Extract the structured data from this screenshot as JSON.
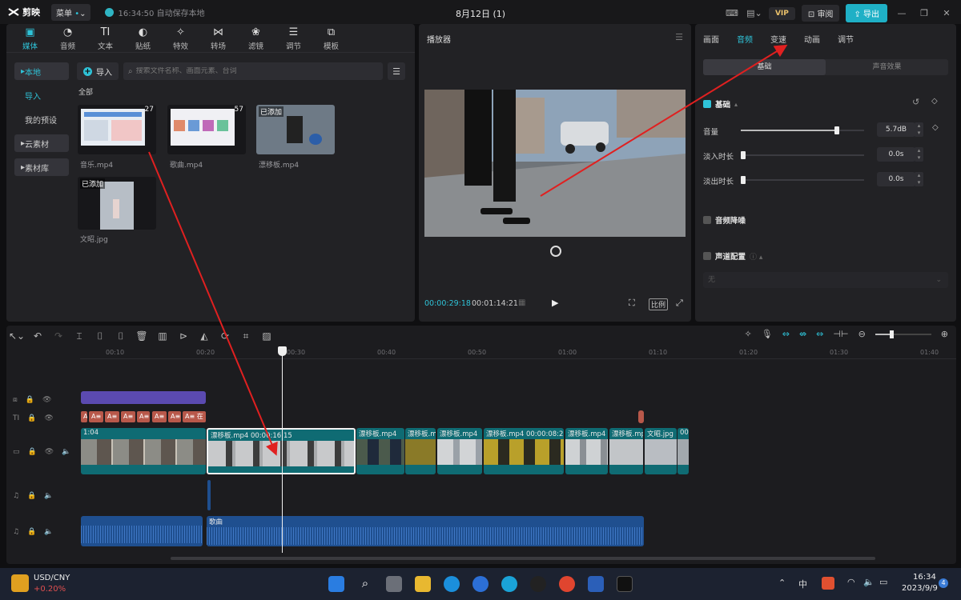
{
  "app": {
    "name": "剪映",
    "menu_label": "菜单",
    "autosave": "16:34:50 自动保存本地",
    "project_title": "8月12日 (1)",
    "vip": "VIP",
    "review": "审阅",
    "export": "导出"
  },
  "media_tabs": [
    {
      "icon": "media-icon",
      "label": "媒体"
    },
    {
      "icon": "audio-icon",
      "label": "音频"
    },
    {
      "icon": "text-icon",
      "label": "文本"
    },
    {
      "icon": "sticker-icon",
      "label": "贴纸"
    },
    {
      "icon": "effects-icon",
      "label": "特效"
    },
    {
      "icon": "transition-icon",
      "label": "转场"
    },
    {
      "icon": "filter-icon",
      "label": "滤镜"
    },
    {
      "icon": "adjust-icon",
      "label": "调节"
    },
    {
      "icon": "template-icon",
      "label": "模板"
    }
  ],
  "side_nav": {
    "local": "本地",
    "import": "导入",
    "presets": "我的预设",
    "cloud": "云素材",
    "library": "素材库"
  },
  "media_toolbar": {
    "import": "导入",
    "search_placeholder": "搜索文件名称、画面元素、台词"
  },
  "media": {
    "all_label": "全部",
    "items": [
      {
        "name": "音乐.mp4",
        "duration": "27",
        "added": ""
      },
      {
        "name": "歌曲.mp4",
        "duration": "57",
        "added": ""
      },
      {
        "name": "漂移板.mp4",
        "duration": "",
        "added": "已添加"
      },
      {
        "name": "文昭.jpg",
        "duration": "",
        "added": "已添加"
      }
    ]
  },
  "player": {
    "title": "播放器",
    "current_time": "00:00:29:18",
    "total_time": "00:01:14:21",
    "ratio_label": "比例"
  },
  "inspector": {
    "tabs": [
      "画面",
      "音频",
      "变速",
      "动画",
      "调节"
    ],
    "active_tab": "音频",
    "subtabs": [
      "基础",
      "声音效果"
    ],
    "section_basic": "基础",
    "volume_label": "音量",
    "volume_value": "5.7dB",
    "volume_level": 0.78,
    "fade_in_label": "淡入时长",
    "fade_in_value": "0.0s",
    "fade_out_label": "淡出时长",
    "fade_out_value": "0.0s",
    "denoise_label": "音频降噪",
    "channel_label": "声道配置",
    "channel_value": "无"
  },
  "timeline": {
    "ruler": [
      "00:10",
      "00:20",
      "00:30",
      "00:40",
      "00:50",
      "01:00",
      "01:10",
      "01:20",
      "01:30",
      "01:40"
    ],
    "text_chip": "A≡",
    "text_chip_last": "A≡ 在",
    "main_clip_start": "1:04",
    "clips": [
      {
        "label": "漂移板.mp4  00:00:16:15"
      },
      {
        "label": "漂移板.mp4"
      },
      {
        "label": "漂移板.mp4"
      },
      {
        "label": "漂移板.mp4"
      },
      {
        "label": "漂移板.mp4  00:00:08:25"
      },
      {
        "label": "漂移板.mp4"
      },
      {
        "label": "漂移板.mp4"
      },
      {
        "label": "文昭.jpg"
      },
      {
        "label": "00:"
      }
    ],
    "audio_clip": "歌曲"
  },
  "taskbar": {
    "ticker": "USD/CNY",
    "change": "+0.20%",
    "ime": "中",
    "time": "16:34",
    "date": "2023/9/9",
    "badge": "4"
  },
  "colors": {
    "accent": "#2fc3d8",
    "annotation": "#e02020",
    "audio_clip": "#1f4f8f",
    "video_clip": "#0f6b73",
    "text_clip": "#b8584a",
    "purple_clip": "#5b4ab0"
  }
}
